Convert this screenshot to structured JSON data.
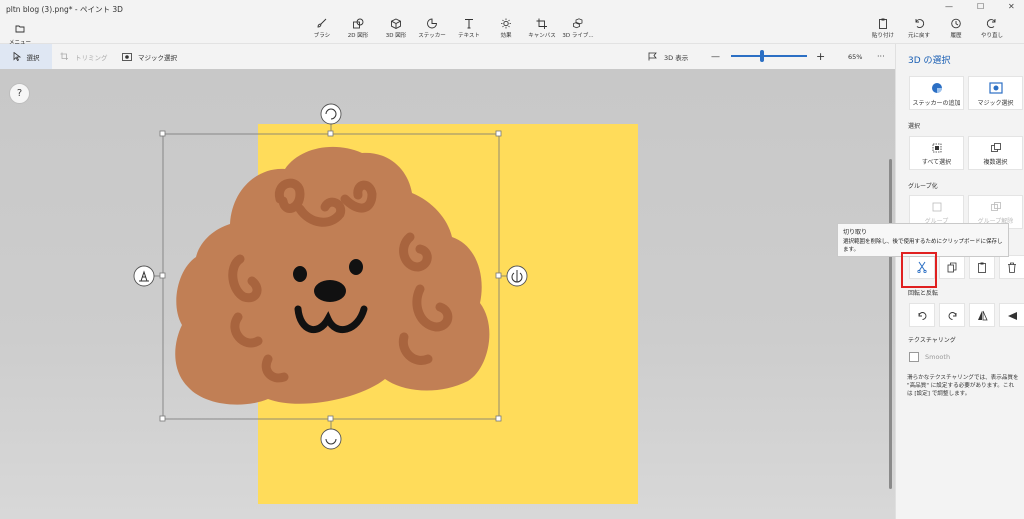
{
  "window": {
    "title": "pltn blog (3).png* - ペイント 3D",
    "controls": [
      "—",
      "☐",
      "✕"
    ]
  },
  "menu": {
    "label": "メニュー"
  },
  "tools": [
    {
      "id": "brush",
      "label": "ブラシ",
      "icon": "brush-icon"
    },
    {
      "id": "shapes2d",
      "label": "2D 図形",
      "icon": "shapes-2d-icon"
    },
    {
      "id": "shapes3d",
      "label": "3D 図形",
      "icon": "cube-icon"
    },
    {
      "id": "stickers",
      "label": "ステッカー",
      "icon": "sticker-icon"
    },
    {
      "id": "text",
      "label": "テキスト",
      "icon": "text-icon"
    },
    {
      "id": "effects",
      "label": "効果",
      "icon": "sun-icon"
    },
    {
      "id": "canvas",
      "label": "キャンバス",
      "icon": "crop-icon"
    },
    {
      "id": "library3d",
      "label": "3D ライブ...",
      "icon": "library-icon"
    }
  ],
  "right_tools": [
    {
      "id": "paste",
      "label": "貼り付け",
      "icon": "paste-icon"
    },
    {
      "id": "undo",
      "label": "元に戻す",
      "icon": "undo-icon"
    },
    {
      "id": "history",
      "label": "履歴",
      "icon": "history-icon"
    },
    {
      "id": "redo",
      "label": "やり直し",
      "icon": "redo-icon"
    }
  ],
  "subbar": {
    "select": "選択",
    "crop": "トリミング",
    "magic_select": "マジック選択",
    "view3d": "3D 表示",
    "zoom_minus": "—",
    "zoom_plus": "+",
    "zoom_level": 65,
    "zoom": "65%",
    "more": "···"
  },
  "canvas": {
    "help": "?",
    "bg_color": "#ffdc5a",
    "poodle_color": "#c17f55",
    "curl_color": "#a8643e"
  },
  "panel": {
    "title": "3D の選択",
    "add_sticker": "ステッカーの追加",
    "magic_select": "マジック選択",
    "select_section": "選択",
    "select_all": "すべて選択",
    "multi_select": "複数選択",
    "group_section": "グループ化",
    "group": "グループ",
    "ungroup": "グループ解除",
    "rotate_flip": "回転と反転",
    "texturing": "テクスチャリング",
    "smooth": "Smooth",
    "texturing_note": "滑らかなテクスチャリングでは、表示品質を \"高品質\" に設定する必要があります。これは [設定] で調整します。"
  },
  "tooltip": {
    "title": "切り取り",
    "body": "選択範囲を削除し、後で使用するためにクリップボードに保存します。"
  }
}
